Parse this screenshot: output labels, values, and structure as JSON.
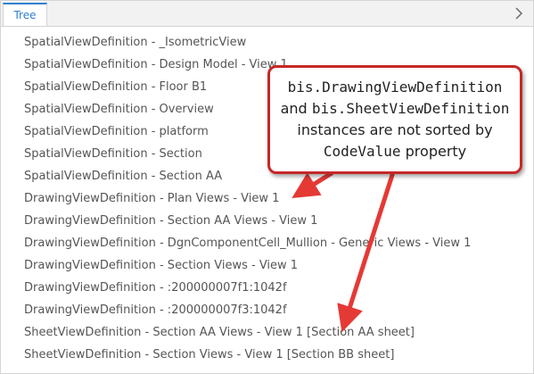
{
  "tabs": [
    {
      "label": "Tree"
    }
  ],
  "tree": {
    "items": [
      {
        "label": "SpatialViewDefinition - _IsometricView"
      },
      {
        "label": "SpatialViewDefinition - Design Model - View 1"
      },
      {
        "label": "SpatialViewDefinition - Floor B1"
      },
      {
        "label": "SpatialViewDefinition - Overview"
      },
      {
        "label": "SpatialViewDefinition - platform"
      },
      {
        "label": "SpatialViewDefinition - Section"
      },
      {
        "label": "SpatialViewDefinition - Section AA"
      },
      {
        "label": "DrawingViewDefinition - Plan Views - View 1"
      },
      {
        "label": "DrawingViewDefinition - Section AA Views - View 1"
      },
      {
        "label": "DrawingViewDefinition - DgnComponentCell_Mullion - Generic Views - View 1"
      },
      {
        "label": "DrawingViewDefinition - Section Views - View 1"
      },
      {
        "label": "DrawingViewDefinition - :200000007f1:1042f"
      },
      {
        "label": "DrawingViewDefinition - :200000007f3:1042f"
      },
      {
        "label": "SheetViewDefinition - Section AA Views - View 1 [Section AA sheet]"
      },
      {
        "label": "SheetViewDefinition - Section Views - View 1 [Section BB sheet]"
      }
    ]
  },
  "callout": {
    "line1": "bis.DrawingViewDefinition",
    "line2_word": "and",
    "line2_code": "bis.SheetViewDefinition",
    "line3": "instances are not sorted by",
    "line4_code": "CodeValue",
    "line4_word": "property"
  },
  "colors": {
    "accent": "#2f7fd1",
    "callout_border": "#c62828",
    "arrow": "#e53935",
    "text": "#555555"
  },
  "icons": {
    "chevron": "chevron-right-icon"
  }
}
